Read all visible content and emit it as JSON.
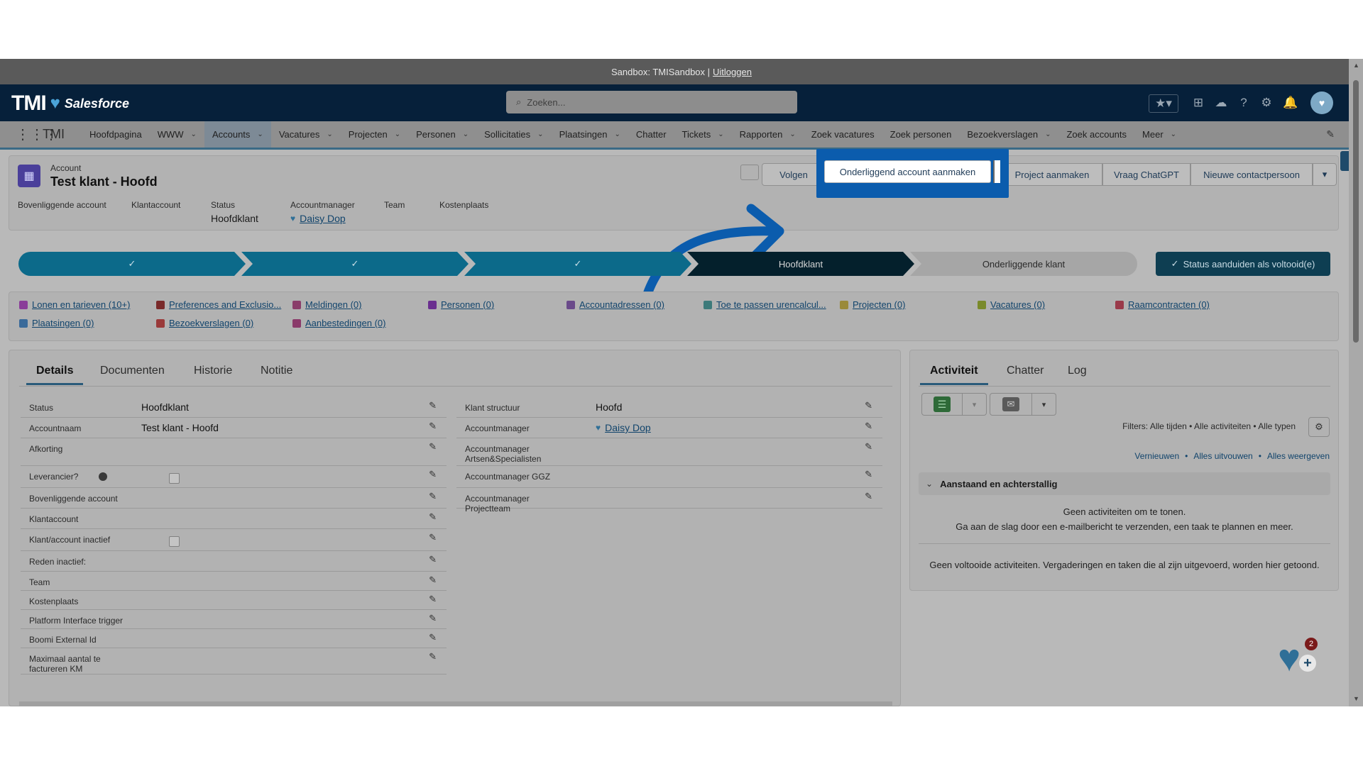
{
  "sandbox": {
    "text": "Sandbox: TMISandbox |",
    "logout": "Uitloggen"
  },
  "header": {
    "logo_text": "TMI",
    "logo_sub": "Salesforce",
    "search_placeholder": "Zoeken...",
    "avatar_icon": "avatar"
  },
  "nav": {
    "app_name": "TMI",
    "items": [
      {
        "label": "Hoofdpagina",
        "chevron": false
      },
      {
        "label": "WWW",
        "chevron": true
      },
      {
        "label": "Accounts",
        "chevron": true
      },
      {
        "label": "Vacatures",
        "chevron": true
      },
      {
        "label": "Projecten",
        "chevron": true
      },
      {
        "label": "Personen",
        "chevron": true
      },
      {
        "label": "Sollicitaties",
        "chevron": true
      },
      {
        "label": "Plaatsingen",
        "chevron": true
      },
      {
        "label": "Chatter",
        "chevron": false
      },
      {
        "label": "Tickets",
        "chevron": true
      },
      {
        "label": "Rapporten",
        "chevron": true
      },
      {
        "label": "Zoek vacatures",
        "chevron": false
      },
      {
        "label": "Zoek personen",
        "chevron": false
      },
      {
        "label": "Bezoekverslagen",
        "chevron": true
      },
      {
        "label": "Zoek accounts",
        "chevron": false
      },
      {
        "label": "Meer",
        "chevron": true
      }
    ]
  },
  "record": {
    "object_label": "Account",
    "title": "Test klant - Hoofd",
    "actions": {
      "follow": "Volgen",
      "create_child": "Onderliggend account aanmaken",
      "create_project": "Project aanmaken",
      "ask_chatgpt": "Vraag ChatGPT",
      "new_contact": "Nieuwe contactpersoon"
    },
    "highlights": [
      {
        "label": "Bovenliggende account",
        "value": ""
      },
      {
        "label": "Klantaccount",
        "value": ""
      },
      {
        "label": "Status",
        "value": "Hoofdklant"
      },
      {
        "label": "Accountmanager",
        "value": "Daisy Dop"
      },
      {
        "label": "Team",
        "value": ""
      },
      {
        "label": "Kostenplaats",
        "value": ""
      }
    ]
  },
  "path": {
    "current": "Hoofdklant",
    "next": "Onderliggende klant",
    "complete_button": "Status aanduiden als voltooid(e)"
  },
  "related": [
    {
      "label": "Lonen en tarieven (10+)",
      "color": "#8a3d99"
    },
    {
      "label": "Preferences and Exclusio...",
      "color": "#7a2a2a"
    },
    {
      "label": "Meldingen (0)",
      "color": "#8a3d6a"
    },
    {
      "label": "Personen (0)",
      "color": "#6a2f8f"
    },
    {
      "label": "Accountadressen (0)",
      "color": "#6a4a8a"
    },
    {
      "label": "Toe te passen urencalcul...",
      "color": "#3d7a7a"
    },
    {
      "label": "Projecten (0)",
      "color": "#9a8a3a"
    },
    {
      "label": "Vacatures (0)",
      "color": "#7a8a2a"
    },
    {
      "label": "Raamcontracten (0)",
      "color": "#9a3a4a"
    },
    {
      "label": "Plaatsingen (0)",
      "color": "#3a6a9a"
    },
    {
      "label": "Bezoekverslagen (0)",
      "color": "#9a3a3a"
    },
    {
      "label": "Aanbestedingen (0)",
      "color": "#8a3a6a"
    }
  ],
  "details": {
    "tabs": [
      "Details",
      "Documenten",
      "Historie",
      "Notitie"
    ],
    "left_fields": [
      {
        "label": "Status",
        "value": "Hoofdklant"
      },
      {
        "label": "Accountnaam",
        "value": "Test klant - Hoofd"
      },
      {
        "label": "Afkorting",
        "value": ""
      },
      {
        "label": "Leverancier?",
        "value": ""
      },
      {
        "label": "Bovenliggende account",
        "value": ""
      },
      {
        "label": "Klantaccount",
        "value": ""
      },
      {
        "label": "Klant/account inactief",
        "value": ""
      },
      {
        "label": "Reden inactief:",
        "value": ""
      },
      {
        "label": "Team",
        "value": ""
      },
      {
        "label": "Kostenplaats",
        "value": ""
      },
      {
        "label": "Platform Interface trigger",
        "value": ""
      },
      {
        "label": "Boomi External Id",
        "value": ""
      },
      {
        "label": "Maximaal aantal te factureren KM",
        "value": ""
      }
    ],
    "right_fields": [
      {
        "label": "Klant structuur",
        "value": "Hoofd"
      },
      {
        "label": "Accountmanager",
        "value": "Daisy Dop"
      },
      {
        "label": "Accountmanager Artsen&Specialisten",
        "value": ""
      },
      {
        "label": "Accountmanager GGZ",
        "value": ""
      },
      {
        "label": "Accountmanager Projectteam",
        "value": ""
      }
    ]
  },
  "activity": {
    "tabs": [
      "Activiteit",
      "Chatter",
      "Log"
    ],
    "filters": "Filters: Alle tijden • Alle activiteiten • Alle typen",
    "links": [
      "Vernieuwen",
      "Alles uitvouwen",
      "Alles weergeven"
    ],
    "section": "Aanstaand en achterstallig",
    "empty_line1": "Geen activiteiten om te tonen.",
    "empty_line2": "Ga aan de slag door een e-mailbericht te verzenden, een taak te plannen en meer.",
    "completed_note": "Geen voltooide activiteiten. Vergaderingen en taken die al zijn uitgevoerd, worden hier getoond."
  },
  "help_badge": "2",
  "colors": {
    "highlight_box": "#0b5cad",
    "arrow": "#0b5cad",
    "path_done": "#0c6a8a",
    "path_current": "#04202c"
  }
}
